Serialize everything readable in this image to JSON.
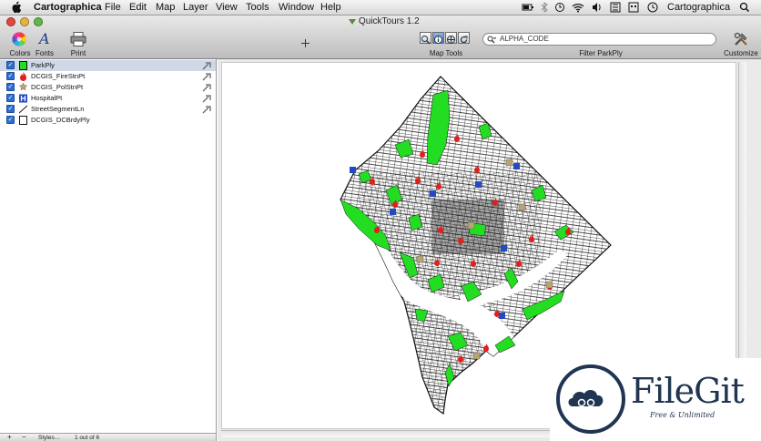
{
  "menubar": {
    "app_name": "Cartographica",
    "menus": [
      "File",
      "Edit",
      "Map",
      "Layer",
      "View",
      "Tools",
      "Window",
      "Help"
    ],
    "status_app_name": "Cartographica",
    "icons": [
      "apple-icon",
      "battery-icon",
      "bluetooth-icon",
      "time-machine-icon",
      "wifi-icon",
      "volume-icon",
      "flag-icon",
      "keyboard-icon",
      "clock-icon",
      "spotlight-icon"
    ]
  },
  "window": {
    "title": "QuickTours 1.2"
  },
  "toolbar": {
    "colors_label": "Colors",
    "fonts_label": "Fonts",
    "print_label": "Print",
    "map_tools_label": "Map Tools",
    "filter_label": "Filter ParkPly",
    "customize_label": "Customize",
    "filter_placeholder": "ALPHA_CODE"
  },
  "layers": [
    {
      "name": "ParkPly",
      "checked": true,
      "selected": true,
      "icon": "green-square-icon"
    },
    {
      "name": "DCGIS_FireStnPt",
      "checked": true,
      "selected": false,
      "icon": "fire-icon"
    },
    {
      "name": "DCGIS_PolStnPt",
      "checked": true,
      "selected": false,
      "icon": "police-badge-icon"
    },
    {
      "name": "HospitalPt",
      "checked": true,
      "selected": false,
      "icon": "hospital-icon"
    },
    {
      "name": "StreetSegmentLn",
      "checked": true,
      "selected": false,
      "icon": "line-icon"
    },
    {
      "name": "DCGIS_DCBrdyPly",
      "checked": true,
      "selected": false,
      "icon": "empty-square-icon"
    }
  ],
  "sidebar_footer": {
    "add": "+",
    "remove": "−",
    "styles": "Styles…",
    "count": "1 out of 6"
  },
  "watermark": {
    "brand": "FileGit",
    "tagline": "Free & Unlimited"
  },
  "colors": {
    "park_green": "#22dd22",
    "fire_red": "#e0201a",
    "hospital_blue": "#2349c4"
  }
}
